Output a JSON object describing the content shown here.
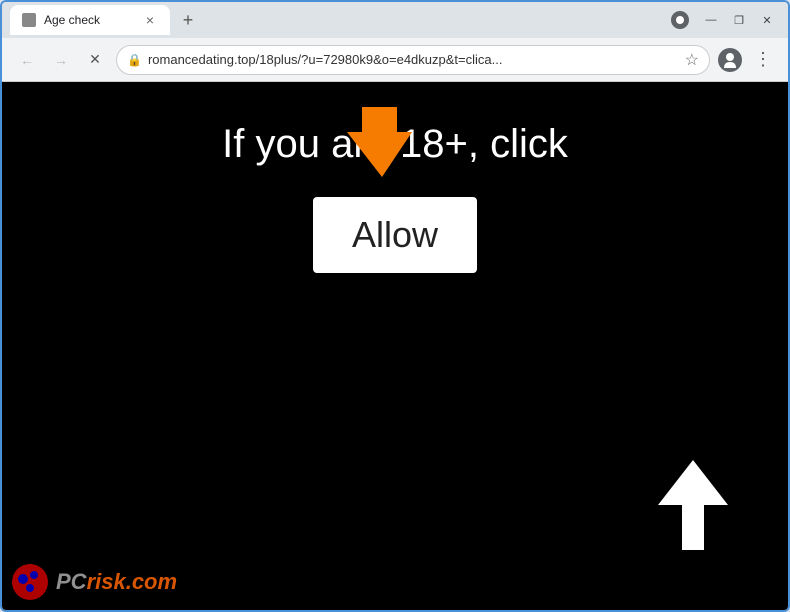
{
  "browser": {
    "tab": {
      "title": "Age check",
      "close_label": "×"
    },
    "new_tab_label": "+",
    "window_controls": {
      "minimize": "—",
      "maximize": "❐",
      "close": "✕"
    },
    "address_bar": {
      "back_icon": "←",
      "forward_icon": "→",
      "reload_icon": "✕",
      "url": "romancedating.top/18plus/?u=72980k9&o=e4dkuzp&t=clica...",
      "lock_icon": "🔒",
      "star_icon": "☆",
      "profile_icon": "👤",
      "menu_icon": "⋮"
    }
  },
  "webpage": {
    "heading": "If you are 18+, click",
    "allow_button_label": "Allow",
    "background_color": "#000000",
    "text_color": "#ffffff"
  },
  "watermark": {
    "site_prefix": "PC",
    "site_suffix": "risk.com"
  }
}
